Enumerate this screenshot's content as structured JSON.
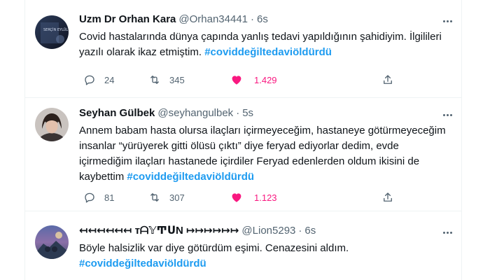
{
  "tweets": [
    {
      "name": "Uzm Dr Orhan Kara",
      "handle": "@Orhan34441",
      "separator": "·",
      "time": "6s",
      "text": "Covid hastalarında dünya çapında yanlış tedavi yapıldığının şahidiyim. İlgilileri yazılı olarak ikaz etmiştim.",
      "hashtag": "#coviddeğiltedaviöldürdü",
      "replies": "24",
      "retweets": "345",
      "likes": "1.429",
      "liked": true,
      "avatar_text": "SERÇİN EYLÜL"
    },
    {
      "name": "Seyhan Gülbek",
      "handle": "@seyhangulbek",
      "separator": "·",
      "time": "5s",
      "text": "Annem babam hasta olursa ilaçları içirmeyeceğim, hastaneye götürmeyeceğim insanlar “yürüyerek gitti ölüsü çıktı” diye feryad ediyorlar dedim, evde içirmediğim ilaçları hastanede içirdiler Feryad edenlerden oldum ikisini de kaybettim",
      "hashtag": "#coviddeğiltedaviöldürdü",
      "replies": "81",
      "retweets": "307",
      "likes": "1.123",
      "liked": true
    },
    {
      "name": "↤↤↤↤↤↤ ᴛᗩ𝕐ͲᑌN ↦↦↦↦↦↦",
      "handle": "@Lion5293",
      "separator": "·",
      "time": "6s",
      "text": "Böyle halsizlik var diye götürdüm eşimi. Cenazesini aldım.",
      "hashtag": "#coviddeğiltedaviöldürdü"
    }
  ],
  "colors": {
    "accent": "#1d9bf0",
    "like": "#f91880",
    "muted": "#536471",
    "border": "#eff3f4"
  }
}
